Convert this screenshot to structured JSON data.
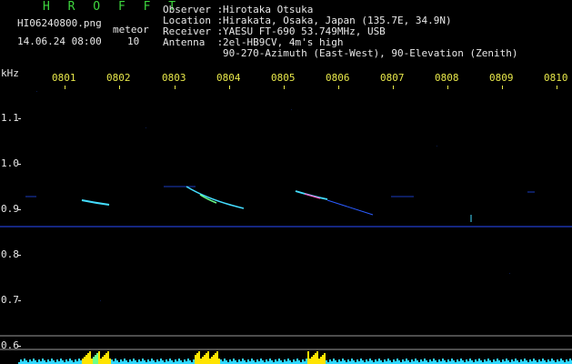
{
  "header": {
    "app_name": "H R O F F T",
    "filename": "HI06240800.png",
    "datetime": "14.06.24 08:00",
    "meteor_label": "meteor",
    "meteor_count": "10"
  },
  "station": {
    "observer_key": "Observer :",
    "observer": "Hirotaka Otsuka",
    "location_key": "Location :",
    "location": "Hirakata, Osaka, Japan (135.7E, 34.9N)",
    "receiver_key": "Receiver :",
    "receiver": "YAESU FT-690 53.749MHz, USB",
    "antenna_key": "Antenna  :",
    "antenna": "2el-HB9CV, 4m's high",
    "antenna_detail": "90-270-Azimuth (East-West), 90-Elevation (Zenith)"
  },
  "axes": {
    "unit": "kHz",
    "time_ticks": [
      "0801",
      "0802",
      "0803",
      "0804",
      "0805",
      "0806",
      "0807",
      "0808",
      "0809",
      "0810"
    ],
    "freq_ticks": [
      "1.1",
      "1.0",
      "0.9",
      "0.8",
      "0.7",
      "0.6"
    ]
  },
  "colors": {
    "label_green": "#3ed63e",
    "label_white": "#e8e8e8",
    "tick_yellow": "#e6e64a",
    "carrier_blue": "#2a4dff",
    "echo_cyan": "#44ddff",
    "echo_green": "#6cff8a",
    "activity_cyan": "#2fd6ff",
    "activity_yellow": "#ffe400"
  }
}
